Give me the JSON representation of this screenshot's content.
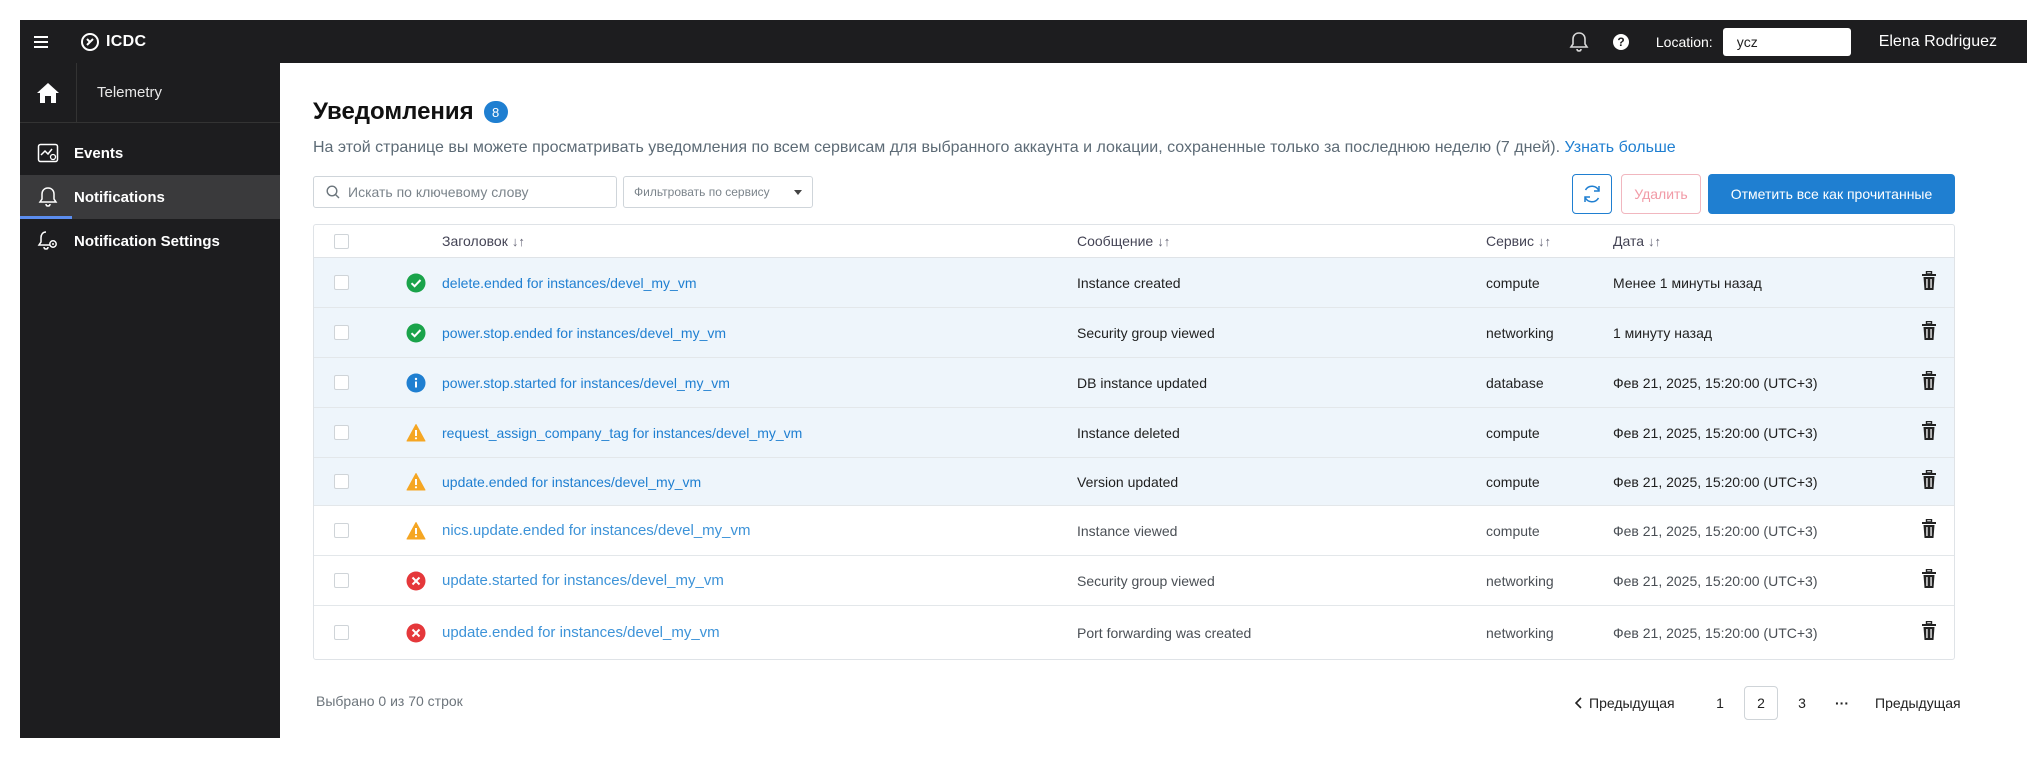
{
  "topbar": {
    "brand": "ICDC",
    "location_label": "Location:",
    "location_value": "ycz",
    "user_name": "Elena Rodriguez"
  },
  "sidebar": {
    "home_label": "Telemetry",
    "items": [
      {
        "label": "Events",
        "icon": "events-icon"
      },
      {
        "label": "Notifications",
        "icon": "bell-icon",
        "active": true
      },
      {
        "label": "Notification Settings",
        "icon": "bell-settings-icon"
      }
    ]
  },
  "page": {
    "title": "Уведомления",
    "count": "8",
    "description": "На этой странице вы можете просматривать уведомления по всем сервисам для выбранного аккаунта и локации, сохраненные только за последнюю неделю (7 дней).",
    "learn_more": "Узнать больше",
    "search_placeholder": "Искать по ключевому слову",
    "filter_placeholder": "Фильтровать по сервису",
    "delete_label": "Удалить",
    "mark_all_label": "Отметить все как прочитанные"
  },
  "table": {
    "columns": {
      "title": "Заголовок",
      "message": "Сообщение",
      "service": "Сервис",
      "date": "Дата"
    },
    "rows": [
      {
        "status": "success",
        "title": "delete.ended for instances/devel_my_vm",
        "message": "Instance created",
        "service": "compute",
        "date": "Менее 1 минуты назад",
        "unread": true
      },
      {
        "status": "success",
        "title": "power.stop.ended for instances/devel_my_vm",
        "message": "Security group viewed",
        "service": "networking",
        "date": "1 минуту назад",
        "unread": true
      },
      {
        "status": "info",
        "title": "power.stop.started for instances/devel_my_vm",
        "message": "DB instance updated",
        "service": "database",
        "date": "Фев 21, 2025, 15:20:00 (UTC+3)",
        "unread": true
      },
      {
        "status": "warning",
        "title": "request_assign_company_tag for instances/devel_my_vm",
        "message": "Instance deleted",
        "service": "compute",
        "date": "Фев 21, 2025, 15:20:00 (UTC+3)",
        "unread": true
      },
      {
        "status": "warning",
        "title": "update.ended for instances/devel_my_vm",
        "message": "Version updated",
        "service": "compute",
        "date": "Фев 21, 2025, 15:20:00 (UTC+3)",
        "unread": true
      },
      {
        "status": "warning",
        "title": "nics.update.ended for instances/devel_my_vm",
        "message": "Instance viewed",
        "service": "compute",
        "date": "Фев 21, 2025, 15:20:00 (UTC+3)",
        "unread": false
      },
      {
        "status": "error",
        "title": "update.started for instances/devel_my_vm",
        "message": "Security group viewed",
        "service": "networking",
        "date": "Фев 21, 2025, 15:20:00 (UTC+3)",
        "unread": false
      },
      {
        "status": "error",
        "title": "update.ended for instances/devel_my_vm",
        "message": "Port forwarding was created",
        "service": "networking",
        "date": "Фев 21, 2025, 15:20:00 (UTC+3)",
        "unread": false
      }
    ]
  },
  "footer": {
    "selected_text": "Выбрано 0 из 70 строк",
    "prev_label": "Предыдущая",
    "pages": [
      "1",
      "2",
      "3"
    ],
    "active_page": "2",
    "ellipsis": "···",
    "next_label": "Предыдущая"
  },
  "colors": {
    "accent": "#1f7fd1",
    "success": "#1aa34a",
    "info": "#1f7fd1",
    "warning": "#f5a623",
    "error": "#e5383b"
  }
}
